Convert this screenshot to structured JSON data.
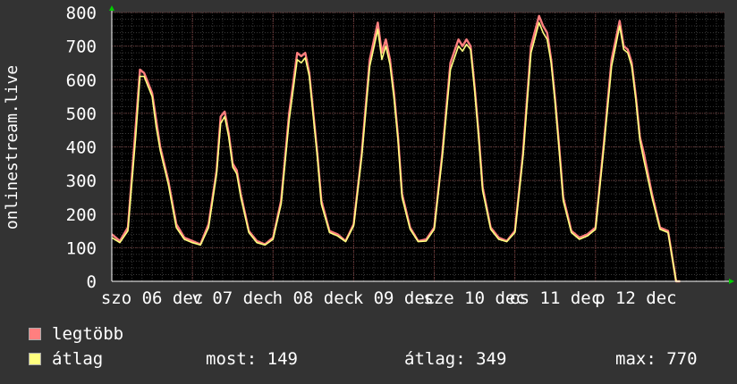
{
  "chart_data": {
    "type": "line",
    "ylabel": "onlinestream.live",
    "ylim": [
      0,
      800
    ],
    "yticks": [
      0,
      100,
      200,
      300,
      400,
      500,
      600,
      700,
      800
    ],
    "grid": true,
    "xlim": [
      0,
      7.6
    ],
    "xtick_labels": [
      {
        "label": "szo 06 dec",
        "pos": 0.5
      },
      {
        "label": "v 07 dec",
        "pos": 1.5
      },
      {
        "label": "h 08 dec",
        "pos": 2.5
      },
      {
        "label": "k 09 dec",
        "pos": 3.5
      },
      {
        "label": "sze 10 dec",
        "pos": 4.5
      },
      {
        "label": "cs 11 dec",
        "pos": 5.5
      },
      {
        "label": "p 12 dec",
        "pos": 6.5
      }
    ],
    "series": [
      {
        "name": "legtöbb",
        "color": "#ff7f7f",
        "x": [
          0,
          0.1,
          0.2,
          0.3,
          0.35,
          0.4,
          0.45,
          0.5,
          0.55,
          0.6,
          0.7,
          0.8,
          0.9,
          1.0,
          1.1,
          1.2,
          1.3,
          1.35,
          1.4,
          1.45,
          1.5,
          1.55,
          1.6,
          1.7,
          1.8,
          1.9,
          2.0,
          2.1,
          2.2,
          2.3,
          2.35,
          2.4,
          2.45,
          2.5,
          2.55,
          2.6,
          2.7,
          2.8,
          2.9,
          3.0,
          3.1,
          3.2,
          3.3,
          3.35,
          3.4,
          3.45,
          3.5,
          3.55,
          3.6,
          3.7,
          3.8,
          3.9,
          4.0,
          4.1,
          4.2,
          4.3,
          4.35,
          4.4,
          4.45,
          4.5,
          4.55,
          4.6,
          4.7,
          4.8,
          4.9,
          5.0,
          5.1,
          5.2,
          5.3,
          5.35,
          5.4,
          5.45,
          5.5,
          5.55,
          5.6,
          5.7,
          5.8,
          5.9,
          6.0,
          6.1,
          6.2,
          6.3,
          6.35,
          6.4,
          6.45,
          6.5,
          6.55,
          6.6,
          6.7,
          6.8,
          6.9,
          7.0,
          7.05
        ],
        "values": [
          140,
          120,
          160,
          470,
          630,
          620,
          590,
          560,
          480,
          400,
          300,
          170,
          130,
          120,
          110,
          170,
          330,
          490,
          505,
          440,
          350,
          330,
          260,
          150,
          120,
          110,
          130,
          240,
          500,
          680,
          670,
          680,
          620,
          500,
          380,
          240,
          150,
          140,
          120,
          170,
          380,
          660,
          770,
          680,
          720,
          660,
          560,
          430,
          260,
          160,
          120,
          125,
          160,
          380,
          650,
          720,
          700,
          720,
          700,
          580,
          440,
          280,
          160,
          130,
          120,
          150,
          380,
          700,
          790,
          760,
          740,
          660,
          540,
          400,
          250,
          150,
          130,
          140,
          160,
          400,
          660,
          775,
          700,
          690,
          650,
          550,
          430,
          380,
          260,
          160,
          150,
          0,
          0
        ]
      },
      {
        "name": "átlag",
        "color": "#ffff7f",
        "x": [
          0,
          0.1,
          0.2,
          0.3,
          0.35,
          0.4,
          0.45,
          0.5,
          0.55,
          0.6,
          0.7,
          0.8,
          0.9,
          1.0,
          1.1,
          1.2,
          1.3,
          1.35,
          1.4,
          1.45,
          1.5,
          1.55,
          1.6,
          1.7,
          1.8,
          1.9,
          2.0,
          2.1,
          2.2,
          2.3,
          2.35,
          2.4,
          2.45,
          2.5,
          2.55,
          2.6,
          2.7,
          2.8,
          2.9,
          3.0,
          3.1,
          3.2,
          3.3,
          3.35,
          3.4,
          3.45,
          3.5,
          3.55,
          3.6,
          3.7,
          3.8,
          3.9,
          4.0,
          4.1,
          4.2,
          4.3,
          4.35,
          4.4,
          4.45,
          4.5,
          4.55,
          4.6,
          4.7,
          4.8,
          4.9,
          5.0,
          5.1,
          5.2,
          5.3,
          5.35,
          5.4,
          5.45,
          5.5,
          5.55,
          5.6,
          5.7,
          5.8,
          5.9,
          6.0,
          6.1,
          6.2,
          6.3,
          6.35,
          6.4,
          6.45,
          6.5,
          6.55,
          6.6,
          6.7,
          6.8,
          6.9,
          7.0,
          7.05
        ],
        "values": [
          130,
          115,
          150,
          440,
          610,
          610,
          580,
          550,
          460,
          390,
          290,
          160,
          125,
          115,
          108,
          160,
          320,
          470,
          490,
          430,
          340,
          320,
          250,
          145,
          115,
          108,
          125,
          230,
          480,
          660,
          650,
          665,
          610,
          490,
          370,
          230,
          145,
          135,
          118,
          165,
          370,
          640,
          750,
          660,
          700,
          645,
          545,
          420,
          250,
          155,
          118,
          120,
          155,
          370,
          630,
          700,
          685,
          705,
          690,
          570,
          430,
          270,
          155,
          125,
          118,
          145,
          370,
          680,
          770,
          740,
          720,
          650,
          530,
          390,
          240,
          145,
          125,
          135,
          155,
          390,
          640,
          760,
          690,
          680,
          640,
          540,
          420,
          360,
          250,
          155,
          145,
          0,
          0
        ]
      }
    ]
  },
  "legend": [
    {
      "label": "legtöbb",
      "color": "#ff7f7f"
    },
    {
      "label": "átlag",
      "color": "#ffff7f"
    }
  ],
  "stats": {
    "most": "most: 149",
    "atlag": "átlag: 349",
    "max": "max: 770"
  }
}
